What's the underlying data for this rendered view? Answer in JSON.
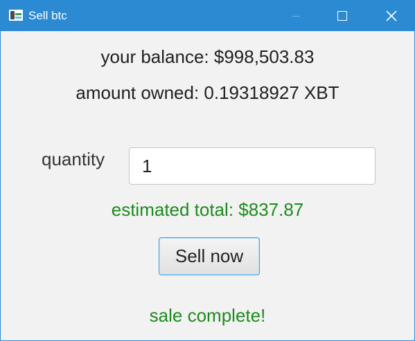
{
  "window": {
    "title": "Sell btc",
    "icon": "app-window-icon",
    "controls": [
      "minimize-icon",
      "maximize-icon",
      "close-icon"
    ],
    "close_glyph": "✕"
  },
  "balance_text": "your balance: $998,503.83",
  "owned_text": "amount owned: 0.19318927 XBT",
  "quantity": {
    "label": "quantity",
    "value": "1"
  },
  "estimate_text": "estimated total: $837.87",
  "sell_button_label": "Sell now",
  "status_text": "sale complete!",
  "colors": {
    "titlebar": "#2b8ad1",
    "success_text": "#1d8a1d",
    "button_focus_border": "#39a0e3"
  }
}
